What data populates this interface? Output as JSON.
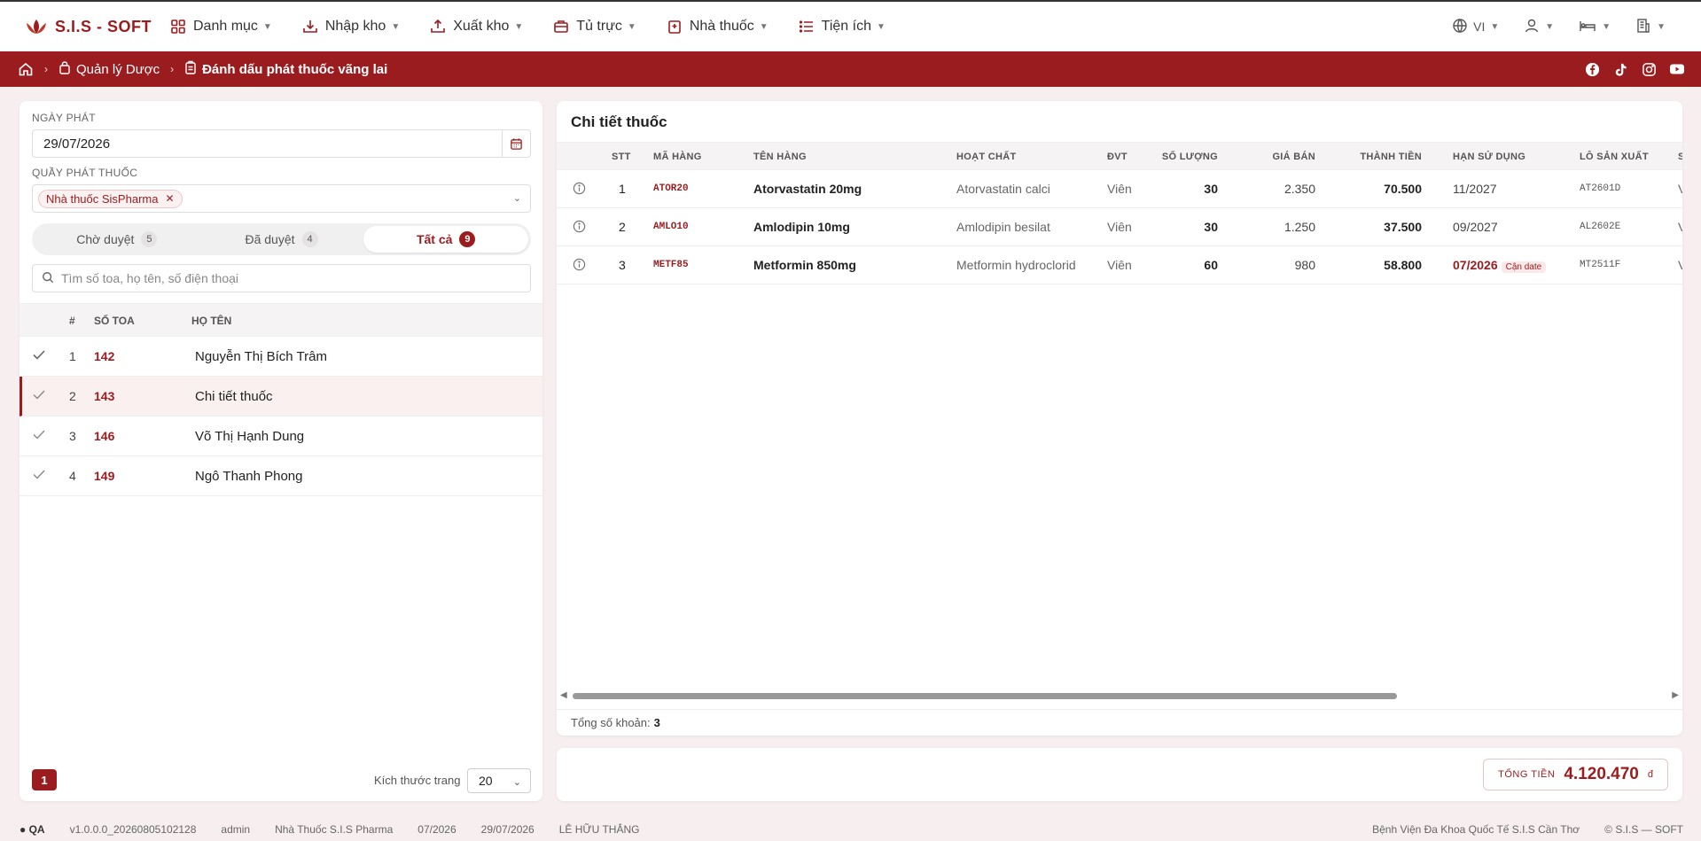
{
  "app": {
    "logo_text": "S.I.S - SOFT"
  },
  "nav": {
    "items": [
      {
        "label": "Danh mục",
        "icon": "grid-icon"
      },
      {
        "label": "Nhập kho",
        "icon": "inbox-download-icon"
      },
      {
        "label": "Xuất kho",
        "icon": "inbox-upload-icon"
      },
      {
        "label": "Tủ trực",
        "icon": "cabinet-icon"
      },
      {
        "label": "Nhà thuốc",
        "icon": "pharmacy-icon"
      },
      {
        "label": "Tiện ích",
        "icon": "list-icon"
      }
    ],
    "language": "VI"
  },
  "breadcrumb": {
    "items": [
      {
        "label": "Quản lý Dược"
      },
      {
        "label": "Đánh dấu phát thuốc vãng lai"
      }
    ]
  },
  "filters": {
    "date_label": "NGÀY PHÁT",
    "date_value": "29/07/2026",
    "counter_label": "QUẦY PHÁT THUỐC",
    "counter_tag": "Nhà thuốc SisPharma",
    "tabs": [
      {
        "label": "Chờ duyệt",
        "count": "5"
      },
      {
        "label": "Đã duyệt",
        "count": "4"
      },
      {
        "label": "Tất cả",
        "count": "9"
      }
    ],
    "search_placeholder": "Tìm số toa, họ tên, số điện thoại"
  },
  "prescriptions": {
    "headers": {
      "num": "#",
      "code": "SỐ TOA",
      "name": "HỌ TÊN"
    },
    "rows": [
      {
        "num": "1",
        "code": "142",
        "name": "Nguyễn Thị Bích Trâm"
      },
      {
        "num": "2",
        "code": "143",
        "name": "Chi tiết thuốc"
      },
      {
        "num": "3",
        "code": "146",
        "name": "Võ Thị Hạnh Dung"
      },
      {
        "num": "4",
        "code": "149",
        "name": "Ngô Thanh Phong"
      }
    ]
  },
  "pagination": {
    "current": "1",
    "size_label": "Kích thước trang",
    "size": "20"
  },
  "detail": {
    "title": "Chi tiết thuốc",
    "headers": {
      "stt": "STT",
      "code": "MÃ HÀNG",
      "name": "TÊN HÀNG",
      "ingredient": "HOẠT CHẤT",
      "unit": "ĐVT",
      "qty": "SỐ LƯỢNG",
      "price": "GIÁ BÁN",
      "amount": "THÀNH TIỀN",
      "expiry": "HẠN SỬ DỤNG",
      "lot": "LÔ SẢN XUẤT",
      "extra": "S"
    },
    "rows": [
      {
        "stt": "1",
        "code": "ATOR20",
        "name": "Atorvastatin 20mg",
        "ingredient": "Atorvastatin calci",
        "unit": "Viên",
        "qty": "30",
        "price": "2.350",
        "amount": "70.500",
        "expiry": "11/2027",
        "expiry_badge": "",
        "lot": "AT2601D",
        "extra": "V"
      },
      {
        "stt": "2",
        "code": "AMLO10",
        "name": "Amlodipin 10mg",
        "ingredient": "Amlodipin besilat",
        "unit": "Viên",
        "qty": "30",
        "price": "1.250",
        "amount": "37.500",
        "expiry": "09/2027",
        "expiry_badge": "",
        "lot": "AL2602E",
        "extra": "V"
      },
      {
        "stt": "3",
        "code": "METF85",
        "name": "Metformin 850mg",
        "ingredient": "Metformin hydroclorid",
        "unit": "Viên",
        "qty": "60",
        "price": "980",
        "amount": "58.800",
        "expiry": "07/2026",
        "expiry_badge": "Cận date",
        "lot": "MT2511F",
        "extra": "V"
      }
    ],
    "footer_label": "Tổng số khoản:",
    "footer_count": "3"
  },
  "total": {
    "label": "TỔNG TIỀN",
    "value": "4.120.470",
    "currency": "đ"
  },
  "statusbar": {
    "env": "● QA",
    "version": "v1.0.0.0_20260805102128",
    "user": "admin",
    "store": "Nhà Thuốc S.I.S Pharma",
    "period": "07/2026",
    "date": "29/07/2026",
    "staff": "LÊ HỮU THẮNG",
    "hospital": "Bệnh Viện Đa Khoa Quốc Tế S.I.S Cần Thơ",
    "copyright": "© S.I.S — SOFT"
  },
  "colors": {
    "brand": "#9b1c1f",
    "background": "#f7efef"
  }
}
